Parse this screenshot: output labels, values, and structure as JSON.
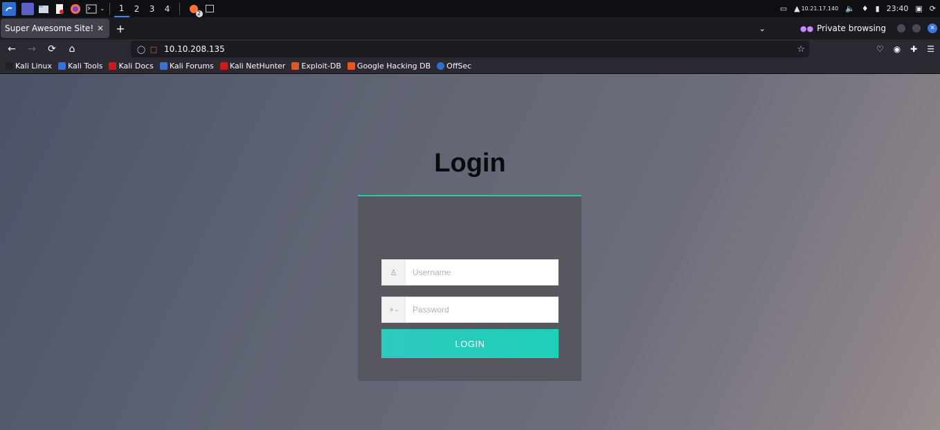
{
  "taskbar": {
    "workspaces": [
      "1",
      "2",
      "3",
      "4"
    ],
    "active_workspace": "1",
    "badge": "2",
    "ip": "10.21.17.140",
    "time": "23:40"
  },
  "browser": {
    "tab_title": "Super Awesome Site!",
    "private_label": "Private browsing",
    "url": "10.10.208.135"
  },
  "bookmarks": [
    {
      "label": "Kali Linux",
      "color": "#222222"
    },
    {
      "label": "Kali Tools",
      "color": "#3b6fd6"
    },
    {
      "label": "Kali Docs",
      "color": "#c91d1d"
    },
    {
      "label": "Kali Forums",
      "color": "#3b6fd6"
    },
    {
      "label": "Kali NetHunter",
      "color": "#c91d1d"
    },
    {
      "label": "Exploit-DB",
      "color": "#e25822"
    },
    {
      "label": "Google Hacking DB",
      "color": "#e25822"
    },
    {
      "label": "OffSec",
      "color": "#2f6fd3"
    }
  ],
  "page": {
    "title": "Login",
    "username_placeholder": "Username",
    "password_placeholder": "Password",
    "login_label": "LOGIN"
  },
  "colors": {
    "accent": "#2bc4b8",
    "button": "#1ed0b6"
  }
}
